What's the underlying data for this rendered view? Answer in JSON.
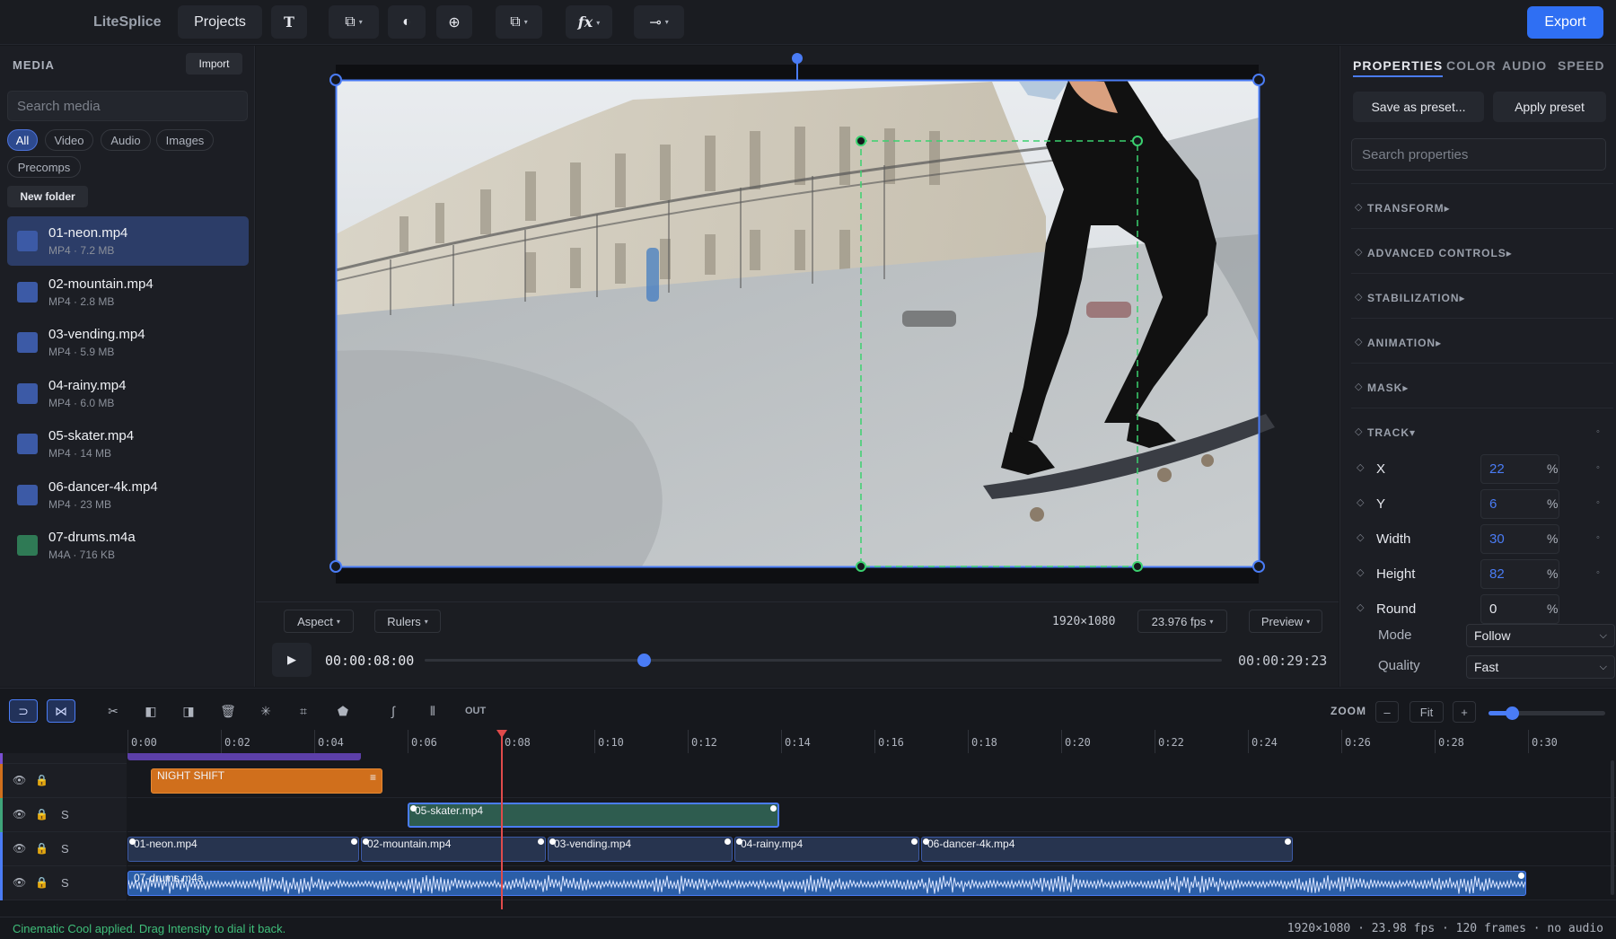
{
  "app": {
    "title": "LiteSplice",
    "projects_label": "Projects",
    "export_label": "Export"
  },
  "media": {
    "title": "MEDIA",
    "import_label": "Import",
    "search_placeholder": "Search media",
    "filters": [
      "All",
      "Video",
      "Audio",
      "Images",
      "Precomps"
    ],
    "active_filter": "All",
    "new_folder_label": "New folder",
    "items": [
      {
        "name": "01-neon.mp4",
        "meta": "MP4 · 7.2 MB",
        "kind": "video"
      },
      {
        "name": "02-mountain.mp4",
        "meta": "MP4 · 2.8 MB",
        "kind": "video"
      },
      {
        "name": "03-vending.mp4",
        "meta": "MP4 · 5.9 MB",
        "kind": "video"
      },
      {
        "name": "04-rainy.mp4",
        "meta": "MP4 · 6.0 MB",
        "kind": "video"
      },
      {
        "name": "05-skater.mp4",
        "meta": "MP4 · 14 MB",
        "kind": "video"
      },
      {
        "name": "06-dancer-4k.mp4",
        "meta": "MP4 · 23 MB",
        "kind": "video"
      },
      {
        "name": "07-drums.m4a",
        "meta": "M4A · 716 KB",
        "kind": "audio"
      }
    ],
    "selected_index": 0
  },
  "viewer": {
    "aspect_label": "Aspect",
    "rulers_label": "Rulers",
    "resolution": "1920×1080",
    "fps_label": "23.976 fps",
    "preview_label": "Preview",
    "current_time": "00:00:08:00",
    "duration": "00:00:29:23",
    "progress": 0.275
  },
  "properties": {
    "tabs": [
      "PROPERTIES",
      "COLOR",
      "AUDIO",
      "SPEED"
    ],
    "active_tab": "PROPERTIES",
    "save_preset_label": "Save as preset...",
    "apply_preset_label": "Apply preset",
    "search_placeholder": "Search properties",
    "sections": [
      "TRANSFORM",
      "ADVANCED CONTROLS",
      "STABILIZATION",
      "ANIMATION",
      "MASK",
      "TRACK"
    ],
    "track_fields": [
      {
        "label": "X",
        "value": "22",
        "unit": "%",
        "highlight": true,
        "keyable": true
      },
      {
        "label": "Y",
        "value": "6",
        "unit": "%",
        "highlight": true,
        "keyable": true
      },
      {
        "label": "Width",
        "value": "30",
        "unit": "%",
        "highlight": true,
        "keyable": true
      },
      {
        "label": "Height",
        "value": "82",
        "unit": "%",
        "highlight": true,
        "keyable": true
      },
      {
        "label": "Round",
        "value": "0",
        "unit": "%",
        "highlight": false,
        "keyable": false
      }
    ],
    "mode_label": "Mode",
    "mode_value": "Follow",
    "quality_label": "Quality",
    "quality_value": "Fast"
  },
  "timeline": {
    "out_label": "OUT",
    "zoom_label": "ZOOM",
    "zoom_minus": "–",
    "zoom_fit": "Fit",
    "zoom_plus": "+",
    "zoom_level": 0.2,
    "ruler_ticks": [
      "0:00",
      "0:02",
      "0:04",
      "0:06",
      "0:08",
      "0:10",
      "0:12",
      "0:14",
      "0:16",
      "0:18",
      "0:20",
      "0:22",
      "0:24",
      "0:26",
      "0:28",
      "0:30"
    ],
    "playhead_seconds": 8.0,
    "title_clip": {
      "label": "NIGHT SHIFT",
      "start": 0.5,
      "end": 5.5
    },
    "broll_clip": {
      "label": "05-skater.mp4",
      "start": 6.0,
      "end": 14.0
    },
    "main_clips": [
      {
        "label": "01-neon.mp4",
        "start": 0.0,
        "end": 5.0
      },
      {
        "label": "02-mountain.mp4",
        "start": 5.0,
        "end": 9.0
      },
      {
        "label": "03-vending.mp4",
        "start": 9.0,
        "end": 13.0
      },
      {
        "label": "04-rainy.mp4",
        "start": 13.0,
        "end": 17.0
      },
      {
        "label": "06-dancer-4k.mp4",
        "start": 17.0,
        "end": 25.0
      }
    ],
    "audio_clip": {
      "label": "07-drums.m4a",
      "start": 0.0,
      "end": 30.0
    },
    "solo_label": "S"
  },
  "status": {
    "message": "Cinematic Cool applied. Drag Intensity to dial it back.",
    "info": "1920×1080 · 23.98 fps · 120 frames · no audio"
  },
  "colors": {
    "accent": "#4a7cf5",
    "export": "#2f6ff3",
    "title_clip": "#d06f1c",
    "broll_clip": "#2e5c4f",
    "audio_clip": "#2b5ea7",
    "playhead": "#e04b4b",
    "status_ok": "#3fbf7a",
    "track_box": "#3bd16f"
  }
}
